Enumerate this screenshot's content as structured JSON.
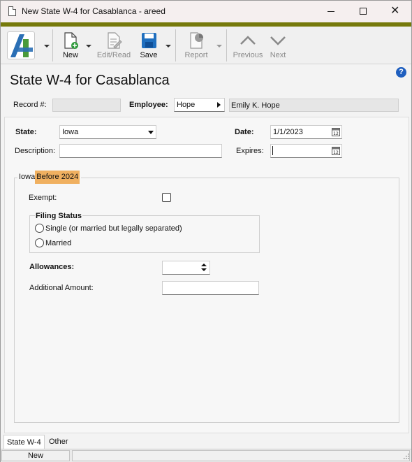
{
  "window": {
    "title": "New State W-4 for Casablanca - areed"
  },
  "toolbar": {
    "new_label": "New",
    "edit_read_label": "Edit/Read",
    "save_label": "Save",
    "report_label": "Report",
    "previous_label": "Previous",
    "next_label": "Next"
  },
  "header": {
    "page_title": "State W-4 for Casablanca",
    "record_label": "Record #:",
    "record_value": "",
    "employee_label": "Employee:",
    "employee_value": "Hope",
    "employee_name": "Emily K. Hope"
  },
  "form": {
    "state_label": "State:",
    "state_value": "Iowa",
    "date_label": "Date:",
    "date_value": "1/1/2023",
    "description_label": "Description:",
    "description_value": "",
    "expires_label": "Expires:",
    "expires_value": ""
  },
  "group": {
    "prefix": "Iowa",
    "highlight": "Before 2024",
    "exempt_label": "Exempt:",
    "filing_status_label": "Filing Status",
    "filing_options": [
      "Single (or married but legally separated)",
      "Married"
    ],
    "allowances_label": "Allowances:",
    "allowances_value": "",
    "additional_amount_label": "Additional Amount:",
    "additional_amount_value": ""
  },
  "tabs": [
    "State W-4",
    "Other"
  ],
  "status": {
    "mode": "New"
  },
  "colors": {
    "accent_strip": "#767a0b",
    "highlight": "#f0b060",
    "save_blue": "#1f6fbf",
    "help_blue": "#1f5fbf"
  }
}
